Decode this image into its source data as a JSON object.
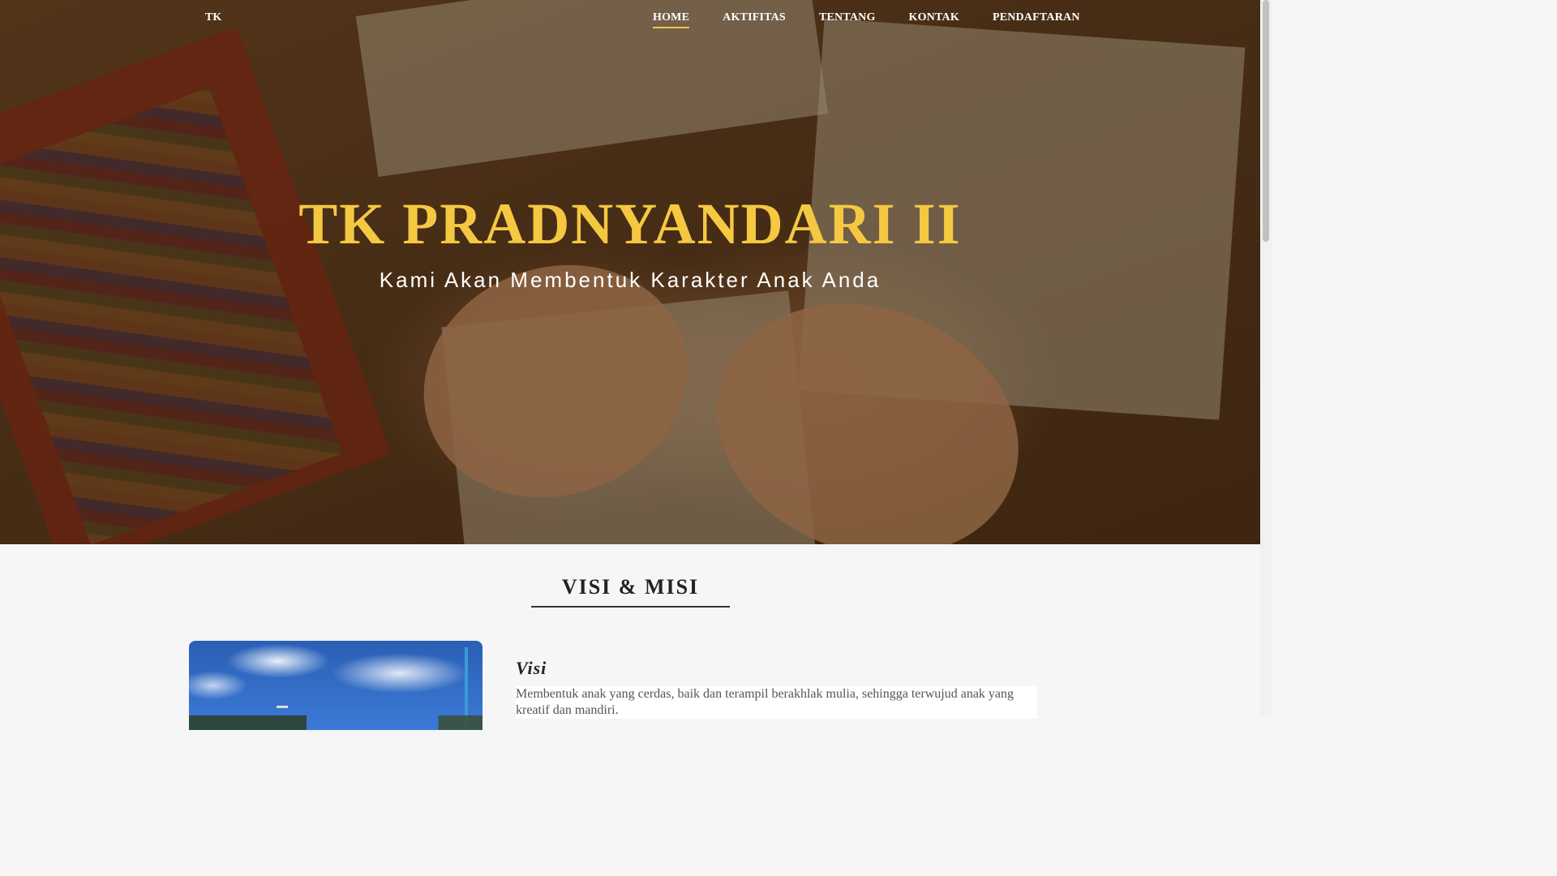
{
  "nav": {
    "logo": "TK",
    "items": [
      {
        "label": "HOME",
        "active": true
      },
      {
        "label": "AKTIFITAS",
        "active": false
      },
      {
        "label": "TENTANG",
        "active": false
      },
      {
        "label": "KONTAK",
        "active": false
      },
      {
        "label": "PENDAFTARAN",
        "active": false
      }
    ]
  },
  "hero": {
    "title": "TK PRADNYANDARI II",
    "subtitle": "Kami Akan Membentuk Karakter Anak Anda"
  },
  "visi_misi": {
    "title": "VISI & MISI",
    "visi_heading": "Visi",
    "visi_text": "Membentuk anak yang cerdas, baik dan terampil berakhlak mulia, sehingga terwujud anak yang kreatif dan mandiri."
  },
  "colors": {
    "accent": "#f5c842",
    "nav_text": "#ffffff",
    "background": "#f6f6f6"
  }
}
